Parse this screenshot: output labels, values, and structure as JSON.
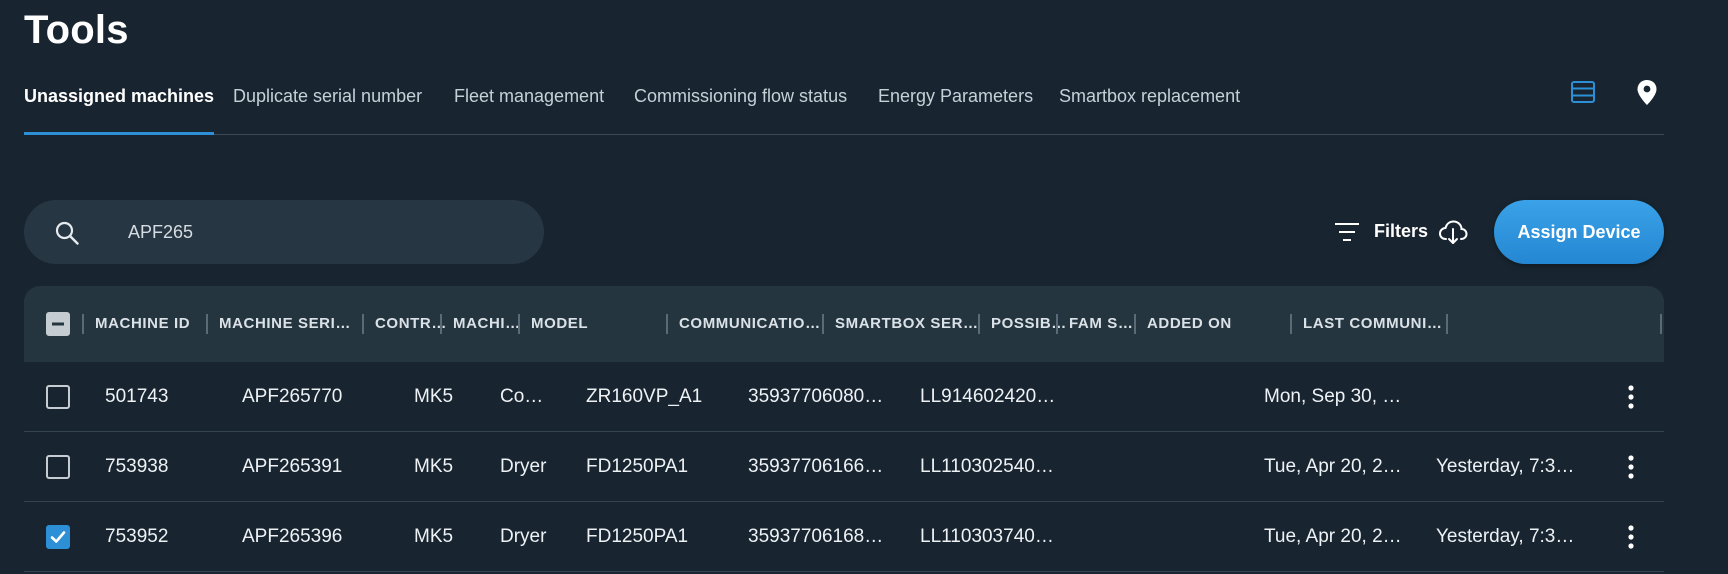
{
  "page": {
    "title": "Tools"
  },
  "tabs": [
    {
      "label": "Unassigned machines",
      "active": true
    },
    {
      "label": "Duplicate serial number",
      "active": false
    },
    {
      "label": "Fleet management",
      "active": false
    },
    {
      "label": "Commissioning flow status",
      "active": false
    },
    {
      "label": "Energy Parameters",
      "active": false
    },
    {
      "label": "Smartbox replacement",
      "active": false
    }
  ],
  "view_icons": [
    "list-view-icon",
    "map-pin-icon"
  ],
  "search": {
    "value": "APF265",
    "placeholder": "Search"
  },
  "toolbar": {
    "filters_label": "Filters",
    "assign_label": "Assign Device"
  },
  "colors": {
    "accent": "#2d8fd6",
    "background": "#182530",
    "header": "#253540"
  },
  "table": {
    "columns": [
      "MACHINE ID",
      "MACHINE SERIAL …",
      "CONTR…",
      "MACHI…",
      "MODEL",
      "COMMUNICATION ID",
      "SMARTBOX SERIAL…",
      "POSSIB…",
      "FAM SO…",
      "ADDED ON",
      "LAST COMMUNICA…"
    ],
    "rows": [
      {
        "checked": false,
        "cells": [
          "501743",
          "APF265770",
          "MK5",
          "Co…",
          "ZR160VP_A1",
          "35937706080…",
          "LL914602420…",
          "",
          "",
          "Mon, Sep 30, …",
          ""
        ]
      },
      {
        "checked": false,
        "cells": [
          "753938",
          "APF265391",
          "MK5",
          "Dryer",
          "FD1250PA1",
          "35937706166…",
          "LL110302540…",
          "",
          "",
          "Tue, Apr 20, 2…",
          "Yesterday, 7:3…"
        ]
      },
      {
        "checked": true,
        "cells": [
          "753952",
          "APF265396",
          "MK5",
          "Dryer",
          "FD1250PA1",
          "35937706168…",
          "LL110303740…",
          "",
          "",
          "Tue, Apr 20, 2…",
          "Yesterday, 7:3…"
        ]
      }
    ]
  }
}
